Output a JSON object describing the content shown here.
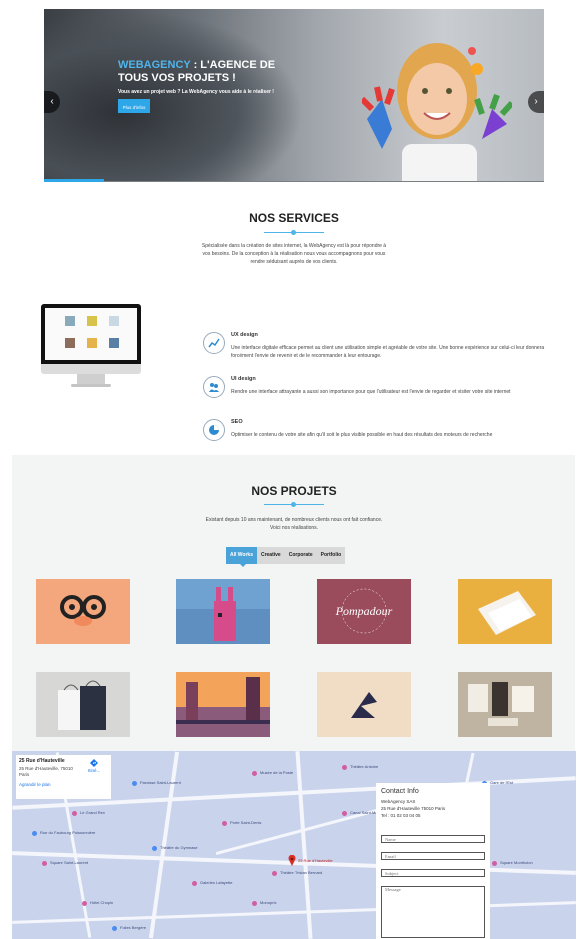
{
  "hero": {
    "title_accent": "WEBAGENCY",
    "title_rest": " : L'AGENCE DE TOUS VOS PROJETS !",
    "subtitle": "Vous avez un projet web ? La WebAgency vous aide à le réaliser !",
    "button": "Plus d'infos",
    "prev_icon": "‹",
    "next_icon": "›"
  },
  "services": {
    "title": "NOS SERVICES",
    "intro_lines": [
      "Spécialisée dans la création de sites internet, la WebAgency est là pour répondre à",
      "vos besoins. De la conception à la réalisation nous vous accompagnons pour vous",
      "rendre séduisant auprès de vos clients."
    ],
    "items": [
      {
        "name": "UX design",
        "icon": "chart-icon",
        "desc": "Une interface digitale efficace permet au client une utilisation simple et agréable de votre site. Une bonne expérience sur celui-ci leur donnera forcément l'envie de revenir et de le recommander à leur entourage."
      },
      {
        "name": "UI design",
        "icon": "users-icon",
        "desc": "Rendre une interface attrayante a aussi son importance pour que l'utilisateur est l'envie de regarder et visiter votre site internet"
      },
      {
        "name": "SEO",
        "icon": "pie-icon",
        "desc": "Optimiser le contenu de votre site afin qu'il soit le plus visible possible en haut des résultats des moteurs de recherche"
      }
    ]
  },
  "projects": {
    "title": "NOS PROJETS",
    "intro_lines": [
      "Existant depuis 10 ans maintenant, de nombreux clients nous ont fait confiance.",
      "Voici nos réalisations."
    ],
    "filters": [
      "All Works",
      "Creative",
      "Corporate",
      "Portfolio"
    ],
    "active_filter": "All Works",
    "thumb_labels": {
      "pompadour": "Pompadour"
    }
  },
  "map": {
    "address_title": "25 Rue d'Hauteville",
    "address_detail": "25 Rue d'Hauteville, 75010 Paris",
    "enlarge": "Agrandir le plan",
    "directions": "Itiné...",
    "marker_label": "25 Rue d'Hauteville",
    "places": [
      "Paroisse Saint-Laurent",
      "Musée de la Poste",
      "Théâtre Antoine",
      "Le Grand Rex",
      "Porte Saint-Denis",
      "Théâtre du Gymnase",
      "Gare de l'Est",
      "Canal Saint-Martin",
      "Square Saint-Laurent",
      "Galeries Lafayette",
      "Hôtel Chopin",
      "Monoprix",
      "Folies Bergère",
      "Théâtre Tristan Bernard",
      "Square Montholon",
      "Rue du Faubourg Poissonnière"
    ]
  },
  "contact": {
    "title": "Contact Info",
    "company": "WebAgency SAS",
    "address": "25 Rue d'Hauteville 75010 Paris",
    "tel": "Tel : 01 02 03 04 05",
    "name_ph": "Name",
    "email_ph": "Email",
    "subject_ph": "Subject",
    "message_ph": "Message"
  }
}
